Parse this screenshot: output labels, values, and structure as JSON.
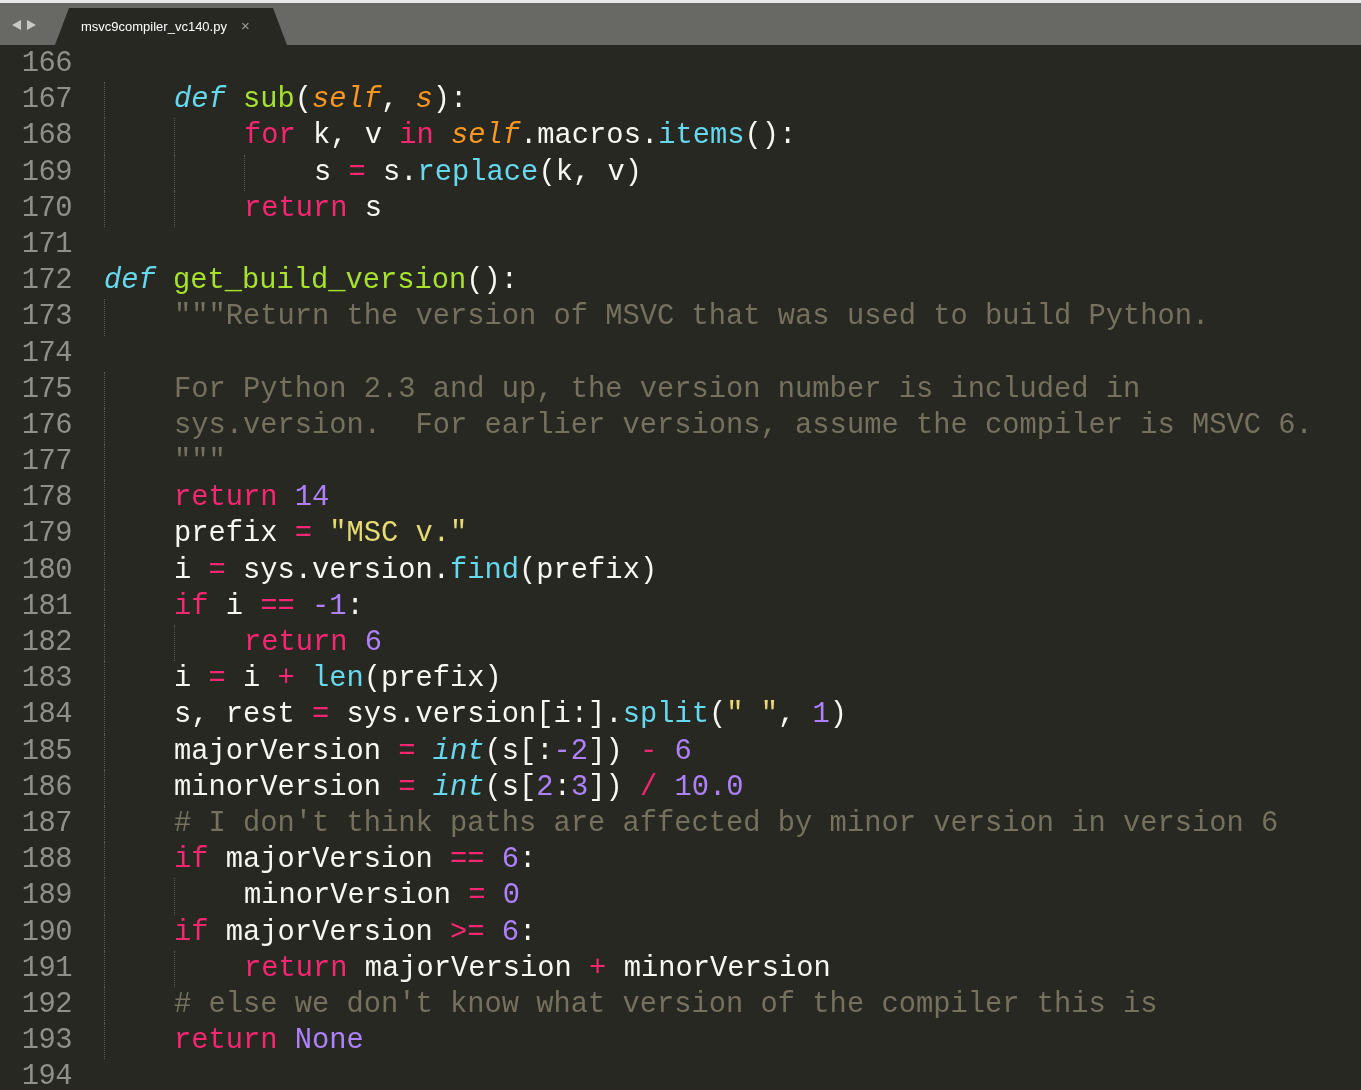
{
  "tab": {
    "title": "msvc9compiler_vc140.py",
    "close": "×",
    "selected": true
  },
  "lines": [
    {
      "number": "166"
    },
    {
      "number": "167",
      "tokens": [
        {
          "kind": "storage",
          "text": "    def"
        },
        {
          "kind": "function",
          "text": " sub"
        },
        {
          "kind": "plain",
          "text": "("
        },
        {
          "kind": "param",
          "text": "self"
        },
        {
          "kind": "plain",
          "text": ", "
        },
        {
          "kind": "param",
          "text": "s"
        },
        {
          "kind": "plain",
          "text": "):"
        }
      ]
    },
    {
      "number": "168",
      "tokens": [
        {
          "kind": "keyword",
          "text": "        for"
        },
        {
          "kind": "plain",
          "text": " k, v "
        },
        {
          "kind": "keyword",
          "text": "in"
        },
        {
          "kind": "param",
          "text": " self"
        },
        {
          "kind": "plain",
          "text": ".macros."
        },
        {
          "kind": "support",
          "text": "items"
        },
        {
          "kind": "plain",
          "text": "():"
        }
      ]
    },
    {
      "number": "169",
      "tokens": [
        {
          "kind": "plain",
          "text": "            s "
        },
        {
          "kind": "operator",
          "text": "="
        },
        {
          "kind": "plain",
          "text": " s."
        },
        {
          "kind": "support",
          "text": "replace"
        },
        {
          "kind": "plain",
          "text": "(k, v)"
        }
      ]
    },
    {
      "number": "170",
      "tokens": [
        {
          "kind": "keyword",
          "text": "        return"
        },
        {
          "kind": "plain",
          "text": " s"
        }
      ]
    },
    {
      "number": "171"
    },
    {
      "number": "172",
      "tokens": [
        {
          "kind": "storage",
          "text": "def"
        },
        {
          "kind": "function",
          "text": " get_build_version"
        },
        {
          "kind": "plain",
          "text": "():"
        }
      ]
    },
    {
      "number": "173",
      "tokens": [
        {
          "kind": "comment",
          "text": "    \"\"\"Return the version of MSVC that was used to build Python."
        }
      ]
    },
    {
      "number": "174"
    },
    {
      "number": "175",
      "tokens": [
        {
          "kind": "comment",
          "text": "    For Python 2.3 and up, the version number is included in"
        }
      ]
    },
    {
      "number": "176",
      "tokens": [
        {
          "kind": "comment",
          "text": "    sys.version.  For earlier versions, assume the compiler is MSVC 6."
        }
      ]
    },
    {
      "number": "177",
      "tokens": [
        {
          "kind": "comment",
          "text": "    \"\"\""
        }
      ]
    },
    {
      "number": "178",
      "tokens": [
        {
          "kind": "keyword",
          "text": "    return"
        },
        {
          "kind": "number",
          "text": " 14"
        }
      ]
    },
    {
      "number": "179",
      "tokens": [
        {
          "kind": "plain",
          "text": "    prefix "
        },
        {
          "kind": "operator",
          "text": "="
        },
        {
          "kind": "string",
          "text": " \"MSC v.\""
        }
      ]
    },
    {
      "number": "180",
      "tokens": [
        {
          "kind": "plain",
          "text": "    i "
        },
        {
          "kind": "operator",
          "text": "="
        },
        {
          "kind": "plain",
          "text": " sys.version."
        },
        {
          "kind": "support",
          "text": "find"
        },
        {
          "kind": "plain",
          "text": "(prefix)"
        }
      ]
    },
    {
      "number": "181",
      "tokens": [
        {
          "kind": "keyword",
          "text": "    if"
        },
        {
          "kind": "plain",
          "text": " i "
        },
        {
          "kind": "operator",
          "text": "=="
        },
        {
          "kind": "number",
          "text": " -1"
        },
        {
          "kind": "plain",
          "text": ":"
        }
      ]
    },
    {
      "number": "182",
      "tokens": [
        {
          "kind": "keyword",
          "text": "        return"
        },
        {
          "kind": "number",
          "text": " 6"
        }
      ]
    },
    {
      "number": "183",
      "tokens": [
        {
          "kind": "plain",
          "text": "    i "
        },
        {
          "kind": "operator",
          "text": "="
        },
        {
          "kind": "plain",
          "text": " i "
        },
        {
          "kind": "operator",
          "text": "+"
        },
        {
          "kind": "support",
          "text": " len"
        },
        {
          "kind": "plain",
          "text": "(prefix)"
        }
      ]
    },
    {
      "number": "184",
      "tokens": [
        {
          "kind": "plain",
          "text": "    s, rest "
        },
        {
          "kind": "operator",
          "text": "="
        },
        {
          "kind": "plain",
          "text": " sys.version[i:]."
        },
        {
          "kind": "support",
          "text": "split"
        },
        {
          "kind": "plain",
          "text": "("
        },
        {
          "kind": "string",
          "text": "\" \""
        },
        {
          "kind": "plain",
          "text": ", "
        },
        {
          "kind": "number",
          "text": "1"
        },
        {
          "kind": "plain",
          "text": ")"
        }
      ]
    },
    {
      "number": "185",
      "tokens": [
        {
          "kind": "plain",
          "text": "    majorVersion "
        },
        {
          "kind": "operator",
          "text": "="
        },
        {
          "kind": "type",
          "text": " int"
        },
        {
          "kind": "plain",
          "text": "(s[:"
        },
        {
          "kind": "number",
          "text": "-2"
        },
        {
          "kind": "plain",
          "text": "]) "
        },
        {
          "kind": "operator",
          "text": "-"
        },
        {
          "kind": "number",
          "text": " 6"
        }
      ]
    },
    {
      "number": "186",
      "tokens": [
        {
          "kind": "plain",
          "text": "    minorVersion "
        },
        {
          "kind": "operator",
          "text": "="
        },
        {
          "kind": "type",
          "text": " int"
        },
        {
          "kind": "plain",
          "text": "(s["
        },
        {
          "kind": "number",
          "text": "2"
        },
        {
          "kind": "plain",
          "text": ":"
        },
        {
          "kind": "number",
          "text": "3"
        },
        {
          "kind": "plain",
          "text": "]) "
        },
        {
          "kind": "operator",
          "text": "/"
        },
        {
          "kind": "number",
          "text": " 10.0"
        }
      ]
    },
    {
      "number": "187",
      "tokens": [
        {
          "kind": "comment",
          "text": "    # I don't think paths are affected by minor version in version 6"
        }
      ]
    },
    {
      "number": "188",
      "tokens": [
        {
          "kind": "keyword",
          "text": "    if"
        },
        {
          "kind": "plain",
          "text": " majorVersion "
        },
        {
          "kind": "operator",
          "text": "=="
        },
        {
          "kind": "number",
          "text": " 6"
        },
        {
          "kind": "plain",
          "text": ":"
        }
      ]
    },
    {
      "number": "189",
      "tokens": [
        {
          "kind": "plain",
          "text": "        minorVersion "
        },
        {
          "kind": "operator",
          "text": "="
        },
        {
          "kind": "number",
          "text": " 0"
        }
      ]
    },
    {
      "number": "190",
      "tokens": [
        {
          "kind": "keyword",
          "text": "    if"
        },
        {
          "kind": "plain",
          "text": " majorVersion "
        },
        {
          "kind": "operator",
          "text": ">="
        },
        {
          "kind": "number",
          "text": " 6"
        },
        {
          "kind": "plain",
          "text": ":"
        }
      ]
    },
    {
      "number": "191",
      "tokens": [
        {
          "kind": "keyword",
          "text": "        return"
        },
        {
          "kind": "plain",
          "text": " majorVersion "
        },
        {
          "kind": "operator",
          "text": "+"
        },
        {
          "kind": "plain",
          "text": " minorVersion"
        }
      ]
    },
    {
      "number": "192",
      "tokens": [
        {
          "kind": "comment",
          "text": "    # else we don't know what version of the compiler this is"
        }
      ]
    },
    {
      "number": "193",
      "tokens": [
        {
          "kind": "keyword",
          "text": "    return"
        },
        {
          "kind": "number",
          "text": " None"
        }
      ]
    },
    {
      "number": "194"
    }
  ]
}
